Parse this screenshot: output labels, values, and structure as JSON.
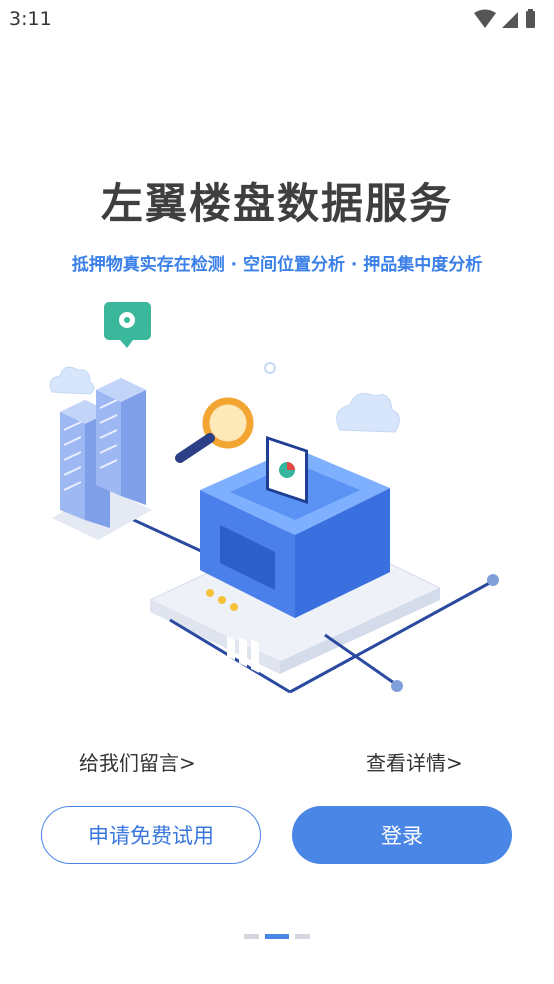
{
  "status_bar": {
    "time": "3:11"
  },
  "headline": "左翼楼盘数据服务",
  "subline": "抵押物真实存在检测 · 空间位置分析 · 押品集中度分析",
  "links": {
    "leave_message": "给我们留言>",
    "view_details": "查看详情>"
  },
  "buttons": {
    "trial": "申请免费试用",
    "login": "登录"
  },
  "pager": {
    "pages": 3,
    "active": 2
  },
  "colors": {
    "accent": "#4a86e6",
    "title": "#3f3f3f",
    "subline": "#3a80e8"
  }
}
